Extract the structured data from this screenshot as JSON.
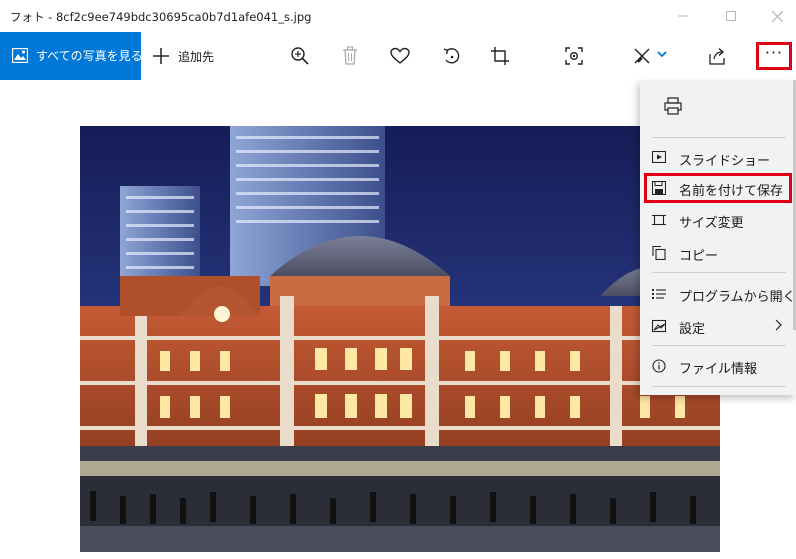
{
  "window": {
    "title": "フォト - 8cf2c9ee749bdc30695ca0b7d1afe041_s.jpg"
  },
  "toolbar": {
    "all_photos_label": "すべての写真を見る",
    "add_label": "追加先",
    "icons": [
      "zoom-icon",
      "delete-icon",
      "favorite-heart-icon",
      "rotate-icon",
      "crop-icon",
      "enhance-icon",
      "edit-draw-icon",
      "share-icon",
      "more-icon"
    ],
    "more_label": "···"
  },
  "menu": {
    "items": [
      {
        "label": "スライドショー",
        "icon": "slideshow-icon"
      },
      {
        "label": "名前を付けて保存",
        "icon": "save-icon"
      },
      {
        "label": "サイズ変更",
        "icon": "resize-icon"
      },
      {
        "label": "コピー",
        "icon": "copy-icon"
      },
      {
        "label": "プログラムから開く",
        "icon": "open-with-icon"
      },
      {
        "label": "設定",
        "icon": "settings-icon"
      },
      {
        "label": "ファイル情報",
        "icon": "info-icon"
      }
    ],
    "highlight_color": "#e00016"
  },
  "colors": {
    "accent": "#0078d7",
    "highlight": "#e00016",
    "menu_bg": "#f2f2f2"
  }
}
